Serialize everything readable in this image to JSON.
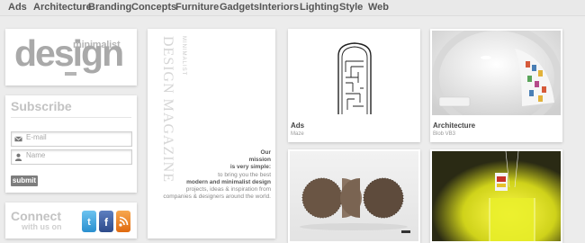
{
  "nav": {
    "items": [
      "Ads",
      "Architecture",
      "Branding",
      "Concepts",
      "Furniture",
      "Gadgets",
      "Interiors",
      "Lighting",
      "Style",
      "Web"
    ]
  },
  "logo": {
    "small": "minimalist",
    "main": "design"
  },
  "subscribe": {
    "title": "Subscribe",
    "email_placeholder": "E-mail",
    "name_placeholder": "Name",
    "submit_label": "submit"
  },
  "connect": {
    "title": "Connect",
    "subtitle": "with us on",
    "icons": [
      "twitter-icon",
      "facebook-icon",
      "rss-icon"
    ]
  },
  "magazine": {
    "vertical_small": "MINIMALIST",
    "vertical_big": "DESIGN MAGAZINE",
    "mission": {
      "line1": "Our",
      "line2": "mission",
      "line3": "is very simple:",
      "line4": "to bring you the best",
      "line5": "modern and minimalist design",
      "line6": "projects, ideas & inspiration from",
      "line7": "companies & designers around the world."
    }
  },
  "posts": [
    {
      "category": "Ads",
      "title": "Maze"
    },
    {
      "category": "Architecture",
      "title": "Blob VB3"
    },
    {
      "category": "",
      "title": ""
    },
    {
      "category": "",
      "title": ""
    }
  ],
  "colors": {
    "background": "#ececec",
    "nav_text": "#555555",
    "accent_twitter": "#3aa0dd",
    "accent_facebook": "#3b5998",
    "accent_rss": "#f08a24"
  }
}
